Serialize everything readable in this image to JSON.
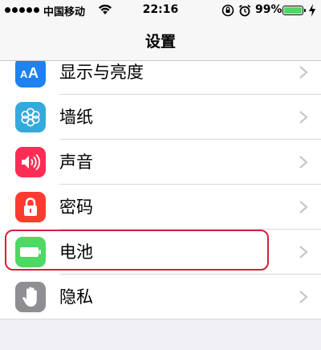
{
  "status_bar": {
    "carrier": "中国移动",
    "time": "22:16",
    "battery_percent_text": "99%",
    "battery_level": 0.99
  },
  "nav": {
    "title": "设置"
  },
  "rows": [
    {
      "label": "显示与亮度",
      "icon": "display-brightness-icon",
      "color": "#1e82f0"
    },
    {
      "label": "墙纸",
      "icon": "wallpaper-flower-icon",
      "color": "#34aadc"
    },
    {
      "label": "声音",
      "icon": "speaker-icon",
      "color": "#ff2d55"
    },
    {
      "label": "密码",
      "icon": "lock-icon",
      "color": "#ff3b30"
    },
    {
      "label": "电池",
      "icon": "battery-icon",
      "color": "#4cd964"
    },
    {
      "label": "隐私",
      "icon": "hand-icon",
      "color": "#8e8e93"
    }
  ],
  "highlighted_row": "电池",
  "highlight_color": "#d8203a"
}
